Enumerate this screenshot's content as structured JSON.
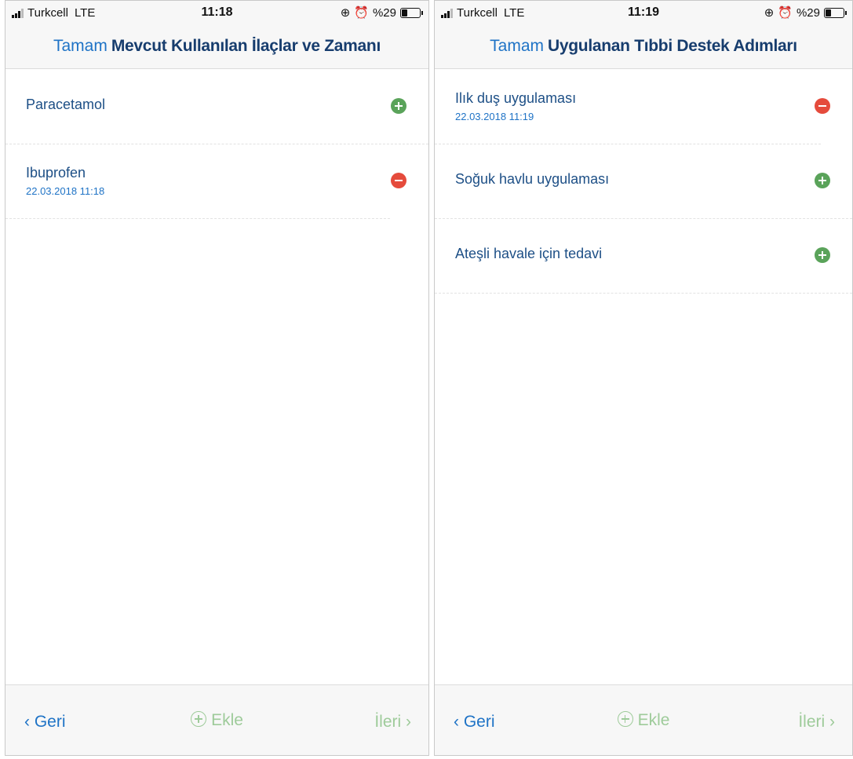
{
  "screens": [
    {
      "status": {
        "carrier": "Turkcell",
        "network": "LTE",
        "time": "11:18",
        "battery": "%29"
      },
      "nav": {
        "done_label": "Tamam",
        "title": "Mevcut Kullanılan İlaçlar ve Zamanı"
      },
      "items": [
        {
          "label": "Paracetamol",
          "timestamp": "",
          "action": "add"
        },
        {
          "label": "Ibuprofen",
          "timestamp": "22.03.2018 11:18",
          "action": "remove"
        }
      ],
      "toolbar": {
        "back_label": "‹ Geri",
        "add_label": "Ekle",
        "next_label": "İleri ›"
      }
    },
    {
      "status": {
        "carrier": "Turkcell",
        "network": "LTE",
        "time": "11:19",
        "battery": "%29"
      },
      "nav": {
        "done_label": "Tamam",
        "title": "Uygulanan Tıbbi Destek Adımları"
      },
      "items": [
        {
          "label": "Ilık duş uygulaması",
          "timestamp": "22.03.2018 11:19",
          "action": "remove"
        },
        {
          "label": "Soğuk havlu uygulaması",
          "timestamp": "",
          "action": "add"
        },
        {
          "label": "Ateşli havale için tedavi",
          "timestamp": "",
          "action": "add"
        }
      ],
      "toolbar": {
        "back_label": "‹ Geri",
        "add_label": "Ekle",
        "next_label": "İleri ›"
      }
    }
  ],
  "icons": {
    "add": "plus-circle-icon",
    "remove": "minus-circle-icon"
  },
  "colors": {
    "accent": "#1f73c6",
    "title": "#173d6e",
    "add": "#5aa35a",
    "remove": "#e54b3c",
    "disabled": "#9ecb9a"
  }
}
